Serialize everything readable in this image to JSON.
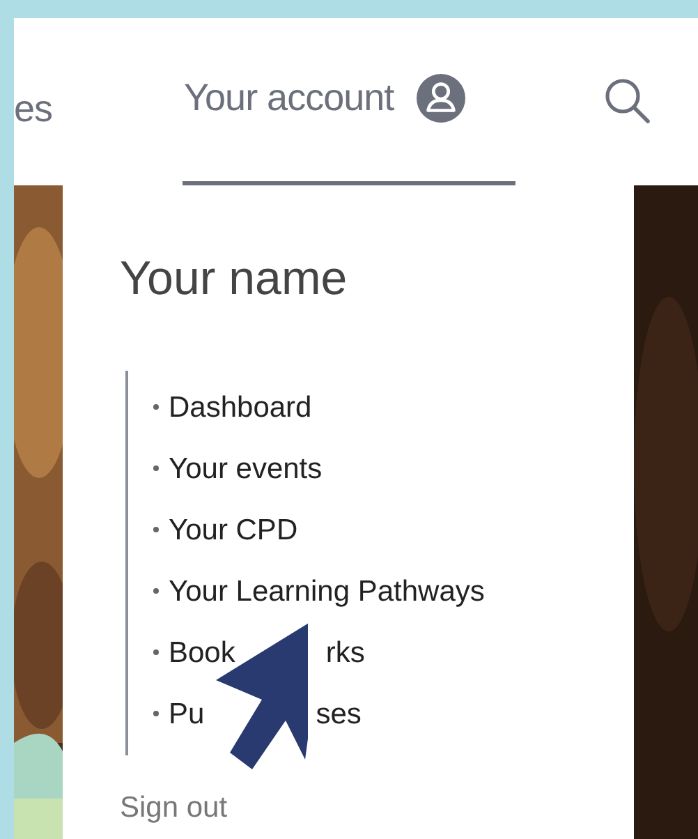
{
  "nav": {
    "items": [
      {
        "label": "es",
        "selected": false
      },
      {
        "label": "Your account",
        "selected": true
      }
    ]
  },
  "account_menu": {
    "name": "Your name",
    "links": [
      {
        "parts": [
          "Dashboard"
        ]
      },
      {
        "parts": [
          "Your events"
        ]
      },
      {
        "parts": [
          "Your CPD"
        ]
      },
      {
        "parts": [
          "Your Learning Pathways"
        ]
      },
      {
        "parts": [
          "Book",
          "rks"
        ]
      },
      {
        "parts": [
          "Pu",
          "ses"
        ]
      }
    ],
    "sign_out": "Sign out"
  }
}
